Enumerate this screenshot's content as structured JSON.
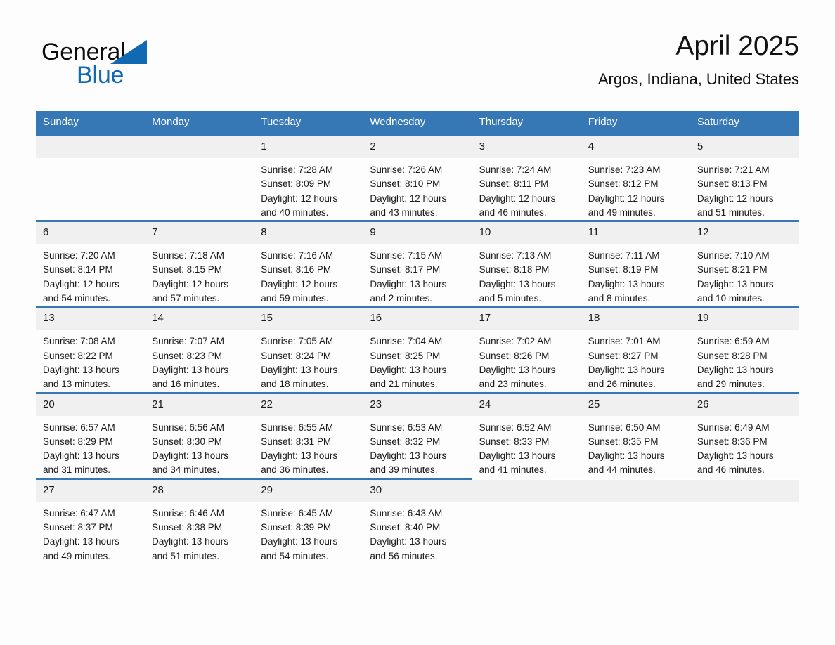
{
  "logo": {
    "word_one": "General",
    "word_two": "Blue",
    "triangle_icon": "triangle-icon",
    "brand_color": "#1168b3"
  },
  "header": {
    "title": "April 2025",
    "subtitle": "Argos, Indiana, United States"
  },
  "colors": {
    "header_blue": "#3578b5",
    "daynum_gray": "#f0f0f0",
    "page_bg": "#fdfdfd",
    "text": "#1a1a1a"
  },
  "weekday_headers": [
    "Sunday",
    "Monday",
    "Tuesday",
    "Wednesday",
    "Thursday",
    "Friday",
    "Saturday"
  ],
  "weeks": [
    [
      {
        "day": "",
        "sunrise": "",
        "sunset": "",
        "daylight_1": "",
        "daylight_2": "",
        "empty": true
      },
      {
        "day": "",
        "sunrise": "",
        "sunset": "",
        "daylight_1": "",
        "daylight_2": "",
        "empty": true
      },
      {
        "day": "1",
        "sunrise": "Sunrise: 7:28 AM",
        "sunset": "Sunset: 8:09 PM",
        "daylight_1": "Daylight: 12 hours",
        "daylight_2": "and 40 minutes."
      },
      {
        "day": "2",
        "sunrise": "Sunrise: 7:26 AM",
        "sunset": "Sunset: 8:10 PM",
        "daylight_1": "Daylight: 12 hours",
        "daylight_2": "and 43 minutes."
      },
      {
        "day": "3",
        "sunrise": "Sunrise: 7:24 AM",
        "sunset": "Sunset: 8:11 PM",
        "daylight_1": "Daylight: 12 hours",
        "daylight_2": "and 46 minutes."
      },
      {
        "day": "4",
        "sunrise": "Sunrise: 7:23 AM",
        "sunset": "Sunset: 8:12 PM",
        "daylight_1": "Daylight: 12 hours",
        "daylight_2": "and 49 minutes."
      },
      {
        "day": "5",
        "sunrise": "Sunrise: 7:21 AM",
        "sunset": "Sunset: 8:13 PM",
        "daylight_1": "Daylight: 12 hours",
        "daylight_2": "and 51 minutes."
      }
    ],
    [
      {
        "day": "6",
        "sunrise": "Sunrise: 7:20 AM",
        "sunset": "Sunset: 8:14 PM",
        "daylight_1": "Daylight: 12 hours",
        "daylight_2": "and 54 minutes."
      },
      {
        "day": "7",
        "sunrise": "Sunrise: 7:18 AM",
        "sunset": "Sunset: 8:15 PM",
        "daylight_1": "Daylight: 12 hours",
        "daylight_2": "and 57 minutes."
      },
      {
        "day": "8",
        "sunrise": "Sunrise: 7:16 AM",
        "sunset": "Sunset: 8:16 PM",
        "daylight_1": "Daylight: 12 hours",
        "daylight_2": "and 59 minutes."
      },
      {
        "day": "9",
        "sunrise": "Sunrise: 7:15 AM",
        "sunset": "Sunset: 8:17 PM",
        "daylight_1": "Daylight: 13 hours",
        "daylight_2": "and 2 minutes."
      },
      {
        "day": "10",
        "sunrise": "Sunrise: 7:13 AM",
        "sunset": "Sunset: 8:18 PM",
        "daylight_1": "Daylight: 13 hours",
        "daylight_2": "and 5 minutes."
      },
      {
        "day": "11",
        "sunrise": "Sunrise: 7:11 AM",
        "sunset": "Sunset: 8:19 PM",
        "daylight_1": "Daylight: 13 hours",
        "daylight_2": "and 8 minutes."
      },
      {
        "day": "12",
        "sunrise": "Sunrise: 7:10 AM",
        "sunset": "Sunset: 8:21 PM",
        "daylight_1": "Daylight: 13 hours",
        "daylight_2": "and 10 minutes."
      }
    ],
    [
      {
        "day": "13",
        "sunrise": "Sunrise: 7:08 AM",
        "sunset": "Sunset: 8:22 PM",
        "daylight_1": "Daylight: 13 hours",
        "daylight_2": "and 13 minutes."
      },
      {
        "day": "14",
        "sunrise": "Sunrise: 7:07 AM",
        "sunset": "Sunset: 8:23 PM",
        "daylight_1": "Daylight: 13 hours",
        "daylight_2": "and 16 minutes."
      },
      {
        "day": "15",
        "sunrise": "Sunrise: 7:05 AM",
        "sunset": "Sunset: 8:24 PM",
        "daylight_1": "Daylight: 13 hours",
        "daylight_2": "and 18 minutes."
      },
      {
        "day": "16",
        "sunrise": "Sunrise: 7:04 AM",
        "sunset": "Sunset: 8:25 PM",
        "daylight_1": "Daylight: 13 hours",
        "daylight_2": "and 21 minutes."
      },
      {
        "day": "17",
        "sunrise": "Sunrise: 7:02 AM",
        "sunset": "Sunset: 8:26 PM",
        "daylight_1": "Daylight: 13 hours",
        "daylight_2": "and 23 minutes."
      },
      {
        "day": "18",
        "sunrise": "Sunrise: 7:01 AM",
        "sunset": "Sunset: 8:27 PM",
        "daylight_1": "Daylight: 13 hours",
        "daylight_2": "and 26 minutes."
      },
      {
        "day": "19",
        "sunrise": "Sunrise: 6:59 AM",
        "sunset": "Sunset: 8:28 PM",
        "daylight_1": "Daylight: 13 hours",
        "daylight_2": "and 29 minutes."
      }
    ],
    [
      {
        "day": "20",
        "sunrise": "Sunrise: 6:57 AM",
        "sunset": "Sunset: 8:29 PM",
        "daylight_1": "Daylight: 13 hours",
        "daylight_2": "and 31 minutes."
      },
      {
        "day": "21",
        "sunrise": "Sunrise: 6:56 AM",
        "sunset": "Sunset: 8:30 PM",
        "daylight_1": "Daylight: 13 hours",
        "daylight_2": "and 34 minutes."
      },
      {
        "day": "22",
        "sunrise": "Sunrise: 6:55 AM",
        "sunset": "Sunset: 8:31 PM",
        "daylight_1": "Daylight: 13 hours",
        "daylight_2": "and 36 minutes."
      },
      {
        "day": "23",
        "sunrise": "Sunrise: 6:53 AM",
        "sunset": "Sunset: 8:32 PM",
        "daylight_1": "Daylight: 13 hours",
        "daylight_2": "and 39 minutes."
      },
      {
        "day": "24",
        "sunrise": "Sunrise: 6:52 AM",
        "sunset": "Sunset: 8:33 PM",
        "daylight_1": "Daylight: 13 hours",
        "daylight_2": "and 41 minutes."
      },
      {
        "day": "25",
        "sunrise": "Sunrise: 6:50 AM",
        "sunset": "Sunset: 8:35 PM",
        "daylight_1": "Daylight: 13 hours",
        "daylight_2": "and 44 minutes."
      },
      {
        "day": "26",
        "sunrise": "Sunrise: 6:49 AM",
        "sunset": "Sunset: 8:36 PM",
        "daylight_1": "Daylight: 13 hours",
        "daylight_2": "and 46 minutes."
      }
    ],
    [
      {
        "day": "27",
        "sunrise": "Sunrise: 6:47 AM",
        "sunset": "Sunset: 8:37 PM",
        "daylight_1": "Daylight: 13 hours",
        "daylight_2": "and 49 minutes."
      },
      {
        "day": "28",
        "sunrise": "Sunrise: 6:46 AM",
        "sunset": "Sunset: 8:38 PM",
        "daylight_1": "Daylight: 13 hours",
        "daylight_2": "and 51 minutes."
      },
      {
        "day": "29",
        "sunrise": "Sunrise: 6:45 AM",
        "sunset": "Sunset: 8:39 PM",
        "daylight_1": "Daylight: 13 hours",
        "daylight_2": "and 54 minutes."
      },
      {
        "day": "30",
        "sunrise": "Sunrise: 6:43 AM",
        "sunset": "Sunset: 8:40 PM",
        "daylight_1": "Daylight: 13 hours",
        "daylight_2": "and 56 minutes."
      },
      {
        "day": "",
        "sunrise": "",
        "sunset": "",
        "daylight_1": "",
        "daylight_2": "",
        "empty": true
      },
      {
        "day": "",
        "sunrise": "",
        "sunset": "",
        "daylight_1": "",
        "daylight_2": "",
        "empty": true
      },
      {
        "day": "",
        "sunrise": "",
        "sunset": "",
        "daylight_1": "",
        "daylight_2": "",
        "empty": true
      }
    ]
  ]
}
